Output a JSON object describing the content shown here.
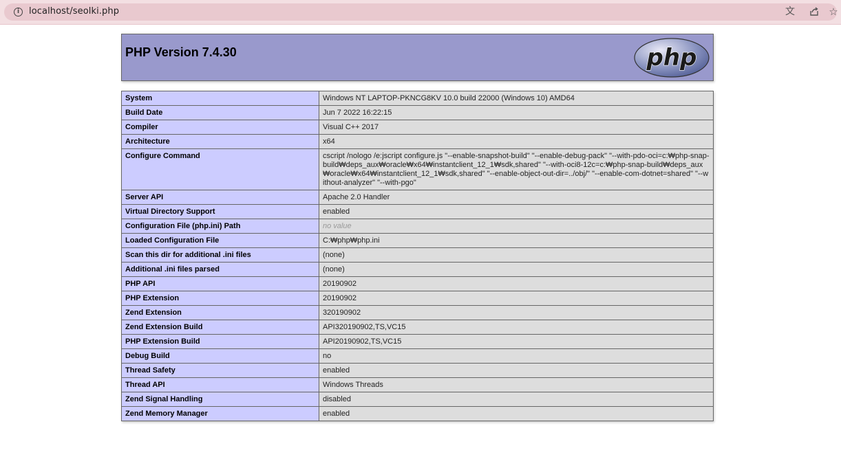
{
  "browser": {
    "url": "localhost/seolki.php",
    "icons": [
      "info-icon",
      "translate-icon",
      "share-icon",
      "bookmark-star-icon"
    ]
  },
  "header": {
    "title": "PHP Version 7.4.30",
    "logo_text": "php",
    "colors": {
      "header_bg": "#9999cc",
      "label_bg": "#ccccff",
      "value_bg": "#dddddd"
    }
  },
  "rows": [
    {
      "label": "System",
      "value": "Windows NT LAPTOP-PKNCG8KV 10.0 build 22000 (Windows 10) AMD64"
    },
    {
      "label": "Build Date",
      "value": "Jun 7 2022 16:22:15"
    },
    {
      "label": "Compiler",
      "value": "Visual C++ 2017"
    },
    {
      "label": "Architecture",
      "value": "x64"
    },
    {
      "label": "Configure Command",
      "value": "cscript /nologo /e:jscript configure.js \"--enable-snapshot-build\" \"--enable-debug-pack\" \"--with-pdo-oci=c:₩php-snap-build₩deps_aux₩oracle₩x64₩instantclient_12_1₩sdk,shared\" \"--with-oci8-12c=c:₩php-snap-build₩deps_aux₩oracle₩x64₩instantclient_12_1₩sdk,shared\" \"--enable-object-out-dir=../obj/\" \"--enable-com-dotnet=shared\" \"--without-analyzer\" \"--with-pgo\""
    },
    {
      "label": "Server API",
      "value": "Apache 2.0 Handler"
    },
    {
      "label": "Virtual Directory Support",
      "value": "enabled"
    },
    {
      "label": "Configuration File (php.ini) Path",
      "value": "no value",
      "novalue": true
    },
    {
      "label": "Loaded Configuration File",
      "value": "C:₩php₩php.ini"
    },
    {
      "label": "Scan this dir for additional .ini files",
      "value": "(none)"
    },
    {
      "label": "Additional .ini files parsed",
      "value": "(none)"
    },
    {
      "label": "PHP API",
      "value": "20190902"
    },
    {
      "label": "PHP Extension",
      "value": "20190902"
    },
    {
      "label": "Zend Extension",
      "value": "320190902"
    },
    {
      "label": "Zend Extension Build",
      "value": "API320190902,TS,VC15"
    },
    {
      "label": "PHP Extension Build",
      "value": "API20190902,TS,VC15"
    },
    {
      "label": "Debug Build",
      "value": "no"
    },
    {
      "label": "Thread Safety",
      "value": "enabled"
    },
    {
      "label": "Thread API",
      "value": "Windows Threads"
    },
    {
      "label": "Zend Signal Handling",
      "value": "disabled"
    },
    {
      "label": "Zend Memory Manager",
      "value": "enabled"
    }
  ]
}
